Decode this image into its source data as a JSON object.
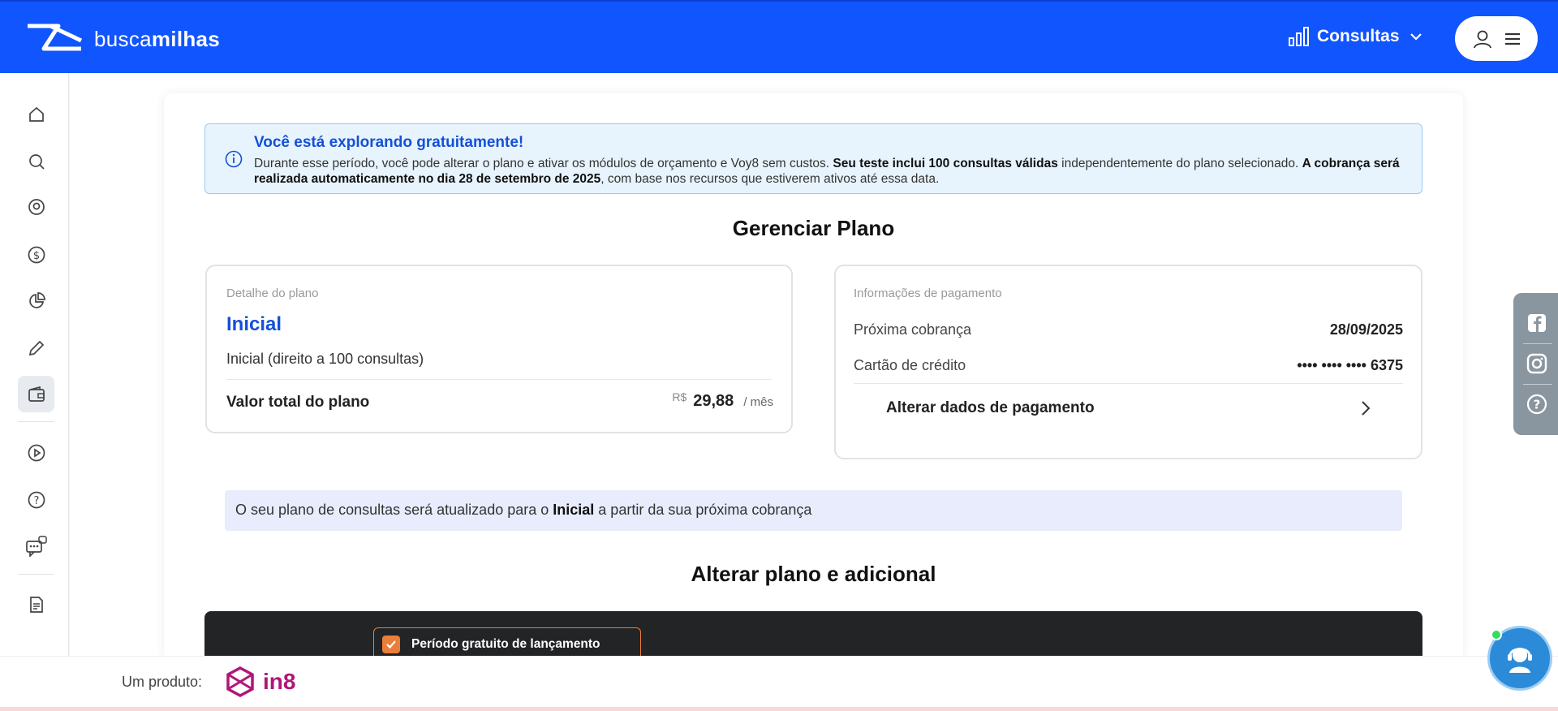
{
  "header": {
    "logo_prefix": "busca",
    "logo_suffix": "milhas",
    "consultas_label": "Consultas"
  },
  "sidebar": {
    "items": [
      {
        "icon": "home-icon"
      },
      {
        "icon": "search-icon"
      },
      {
        "icon": "map-pin-icon"
      },
      {
        "icon": "dollar-icon"
      },
      {
        "icon": "pie-chart-icon"
      },
      {
        "icon": "pencil-icon"
      },
      {
        "icon": "wallet-icon",
        "active": true
      },
      {
        "icon": "play-icon"
      },
      {
        "icon": "help-icon"
      },
      {
        "icon": "chat-bot-icon"
      },
      {
        "icon": "document-icon"
      }
    ]
  },
  "notice": {
    "title": "Você está explorando gratuitamente!",
    "body_1": "Durante esse período, você pode alterar o plano e ativar os módulos de orçamento e Voy8 sem custos. ",
    "body_bold_1": "Seu teste inclui 100 consultas válidas",
    "body_2": " independentemente do plano selecionado. ",
    "body_bold_2": "A cobrança será realizada automaticamente no dia 28 de setembro de 2025",
    "body_3": ", com base nos recursos que estiverem ativos até essa data."
  },
  "manage": {
    "title": "Gerenciar Plano"
  },
  "plan_detail": {
    "caption": "Detalhe do plano",
    "name": "Inicial",
    "description": "Inicial (direito a 100 consultas)",
    "total_label": "Valor total do plano",
    "currency": "R$",
    "price": "29,88",
    "period": "/ mês"
  },
  "payment": {
    "caption": "Informações de pagamento",
    "next_charge_label": "Próxima cobrança",
    "next_charge_value": "28/09/2025",
    "card_label": "Cartão de crédito",
    "card_value": "•••• •••• •••• 6375",
    "change_label": "Alterar dados de pagamento"
  },
  "update_banner": {
    "text_1": "O seu plano de consultas será atualizado para o ",
    "bold": "Inicial",
    "text_2": " a partir da sua próxima cobrança"
  },
  "change_plan": {
    "title": "Alterar plano e adicional",
    "promo_label": "Período gratuito de lançamento"
  },
  "social": [
    "facebook-icon",
    "instagram-icon",
    "help-icon"
  ],
  "footer": {
    "label": "Um produto:",
    "brand": "in8"
  },
  "colors": {
    "brand_blue": "#1155ff",
    "link_blue": "#1450d8",
    "promo_orange": "#e87e3a",
    "in8_magenta": "#b0167a"
  }
}
